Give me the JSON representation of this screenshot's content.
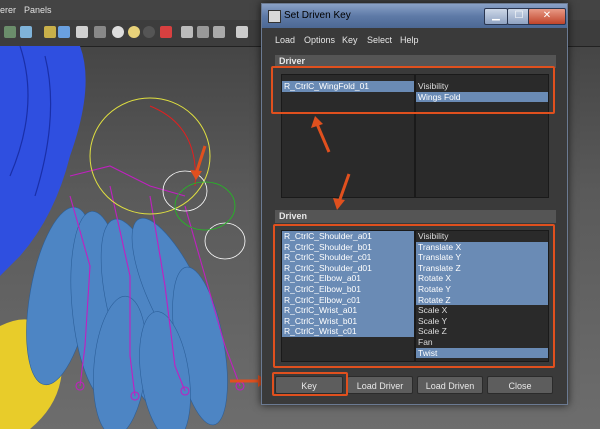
{
  "background_app": {
    "menu": [
      "erer",
      "Panels"
    ]
  },
  "window": {
    "title": "Set Driven Key",
    "minimize": "▁",
    "maximize": "☐",
    "close": "✕"
  },
  "menu": [
    "Load",
    "Options",
    "Key",
    "Select",
    "Help"
  ],
  "driver": {
    "header": "Driver",
    "objects": [
      {
        "label": "R_CtrlC_WingFold_01",
        "selected": true
      }
    ],
    "attributes": [
      {
        "label": "Visibility",
        "selected": false
      },
      {
        "label": "Wings Fold",
        "selected": true
      }
    ]
  },
  "driven": {
    "header": "Driven",
    "objects": [
      {
        "label": "R_CtrlC_Shoulder_a01",
        "selected": true
      },
      {
        "label": "R_CtrlC_Shoulder_b01",
        "selected": true
      },
      {
        "label": "R_CtrlC_Shoulder_c01",
        "selected": true
      },
      {
        "label": "R_CtrlC_Shoulder_d01",
        "selected": true
      },
      {
        "label": "R_CtrlC_Elbow_a01",
        "selected": true
      },
      {
        "label": "R_CtrlC_Elbow_b01",
        "selected": true
      },
      {
        "label": "R_CtrlC_Elbow_c01",
        "selected": true
      },
      {
        "label": "R_CtrlC_Wrist_a01",
        "selected": true
      },
      {
        "label": "R_CtrlC_Wrist_b01",
        "selected": true
      },
      {
        "label": "R_CtrlC_Wrist_c01",
        "selected": true
      }
    ],
    "attributes": [
      {
        "label": "Visibility",
        "selected": false
      },
      {
        "label": "Translate X",
        "selected": true
      },
      {
        "label": "Translate Y",
        "selected": true
      },
      {
        "label": "Translate Z",
        "selected": true
      },
      {
        "label": "Rotate X",
        "selected": true
      },
      {
        "label": "Rotate Y",
        "selected": true
      },
      {
        "label": "Rotate Z",
        "selected": true
      },
      {
        "label": "Scale X",
        "selected": false
      },
      {
        "label": "Scale Y",
        "selected": false
      },
      {
        "label": "Scale Z",
        "selected": false
      },
      {
        "label": "Fan",
        "selected": false
      },
      {
        "label": "Twist",
        "selected": true
      }
    ]
  },
  "buttons": {
    "key": "Key",
    "load_driver": "Load Driver",
    "load_driven": "Load Driven",
    "close": "Close"
  },
  "colors": {
    "highlight": "#e0501e",
    "selection": "#6a8bb5",
    "feather": "#5a8fc8",
    "rig_lines": "#c020c0"
  }
}
